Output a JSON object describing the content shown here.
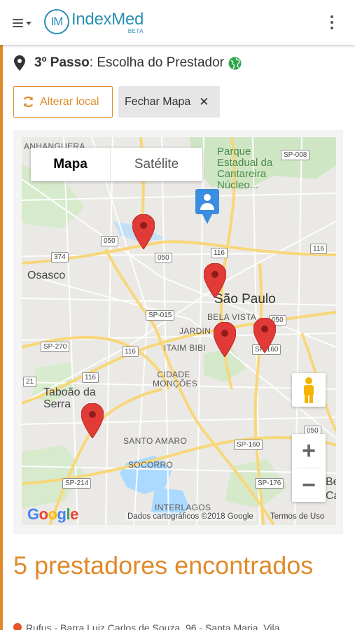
{
  "header": {
    "logo_initials": "IM",
    "logo_name": "IndexMed",
    "logo_badge": "BETA"
  },
  "step": {
    "number": "3º Passo",
    "title": ": Escolha do Prestador"
  },
  "buttons": {
    "change_location": "Alterar local",
    "close_map": "Fechar Mapa"
  },
  "map": {
    "type_options": [
      "Mapa",
      "Satélite"
    ],
    "selected_type": "Mapa",
    "labels": {
      "anhanguera": "ANHANGUERA",
      "park": "Parque Estadual da Cantareira Núcleo...",
      "osasco": "Osasco",
      "sao_paulo": "São Paulo",
      "bela_vista": "BELA VISTA",
      "jardins": "JARDIN",
      "itaim_bibi": "ITAIM BIBI",
      "cidade_moncoes": "CIDADE MONÇÕES",
      "taboao": "Taboão da Serra",
      "santo_amaro": "SANTO AMARO",
      "socorro": "SOCORRO",
      "interlagos": "INTERLAGOS",
      "edge_be": "Be",
      "edge_ca": "Ca"
    },
    "shields": [
      "SP-008",
      "050",
      "374",
      "116",
      "116",
      "SP-015",
      "050",
      "SP-270",
      "116",
      "SP-160",
      "21",
      "116",
      "050",
      "SP-160",
      "SP-214",
      "SP-176",
      "050"
    ],
    "zoom_in": "+",
    "zoom_out": "−",
    "google_logo": "Google",
    "attribution": "Dados cartográficos ©2018 Google",
    "terms": "Termos de Uso",
    "provider_markers": 5
  },
  "results": {
    "count_text": "5 prestadores encontrados",
    "first_address": "Rufus - Barra Luiz Carlos de Souza, 96 - Santa Maria, Vila ..."
  },
  "colors": {
    "accent": "#e08a2c",
    "brand": "#2a8fb3",
    "marker": "#e23b37",
    "user_marker": "#3b8de0"
  }
}
